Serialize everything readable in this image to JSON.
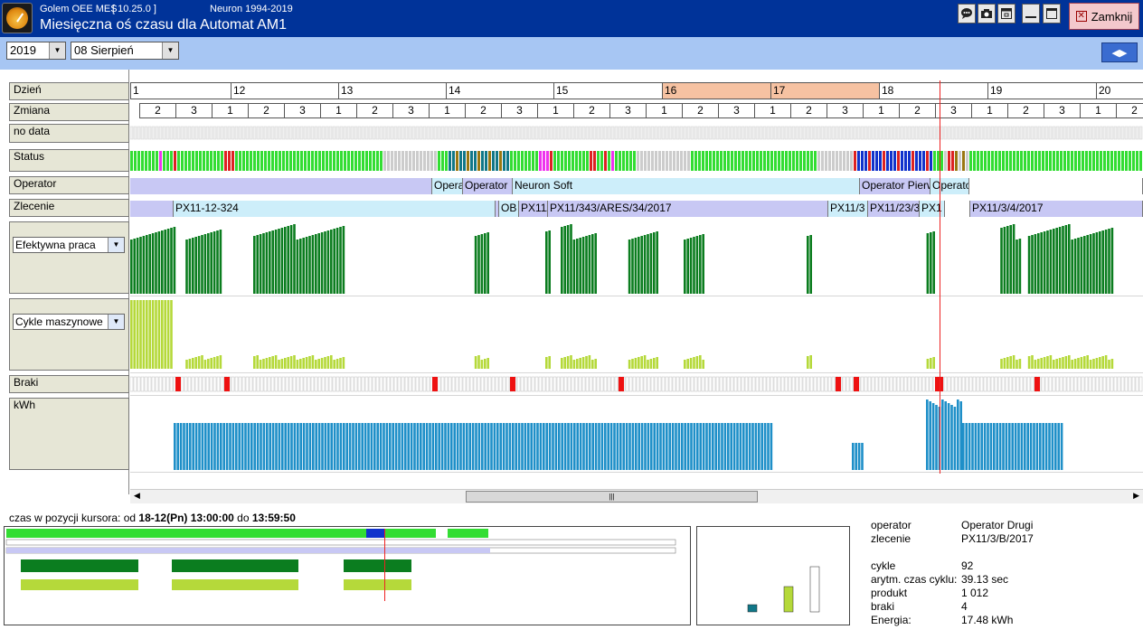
{
  "titlebar": {
    "app_name": "Golem OEE MES",
    "version": "[  10.25.0 ]",
    "copyright": "Neuron 1994-2019",
    "window_title": "Miesięczna oś czasu dla Automat AM1",
    "close_label": "Zamknij"
  },
  "toolbar": {
    "year": "2019",
    "month": "08  Sierpień"
  },
  "row_labels": {
    "day": "Dzień",
    "shift": "Zmiana",
    "nodata": "no data",
    "status": "Status",
    "operator": "Operator",
    "order": "Zlecenie",
    "effective": "Efektywna praca",
    "cycles": "Cykle maszynowe",
    "scrap": "Braki",
    "kwh": "kWh"
  },
  "days": [
    {
      "label": "1",
      "highlight": false
    },
    {
      "label": "12",
      "highlight": false
    },
    {
      "label": "13",
      "highlight": false
    },
    {
      "label": "14",
      "highlight": false
    },
    {
      "label": "15",
      "highlight": false
    },
    {
      "label": "16",
      "highlight": true
    },
    {
      "label": "17",
      "highlight": true
    },
    {
      "label": "18",
      "highlight": false
    },
    {
      "label": "19",
      "highlight": false
    },
    {
      "label": "20",
      "highlight": false
    }
  ],
  "shifts": [
    "2",
    "3",
    "1",
    "2",
    "3",
    "1",
    "2",
    "3",
    "1",
    "2",
    "3",
    "1",
    "2",
    "3",
    "1",
    "2",
    "3",
    "1",
    "2",
    "3",
    "1",
    "2",
    "3",
    "1",
    "2",
    "3",
    "1",
    "2"
  ],
  "operator_segments": [
    {
      "label": "",
      "color": "#c8c8f4"
    },
    {
      "label": "Operato",
      "color": "#cdeefa"
    },
    {
      "label": "Operator",
      "color": "#c8c8f4"
    },
    {
      "label": "Neuron Soft",
      "color": "#cdeefa"
    },
    {
      "label": "Operator Pierwszy",
      "color": "#c8c8f4"
    },
    {
      "label": "Operator",
      "color": "#cdeefa"
    },
    {
      "label": "",
      "color": "#ffffff"
    }
  ],
  "order_segments": [
    {
      "label": "",
      "color": "#c8c8f4"
    },
    {
      "label": "PX11-12-324",
      "color": "#cdeefa"
    },
    {
      "label": "I",
      "color": "#c8c8f4"
    },
    {
      "label": "OB",
      "color": "#cdeefa"
    },
    {
      "label": "PX11/",
      "color": "#c8c8f4"
    },
    {
      "label": "PX11/343/ARES/34/2017",
      "color": "#c8c8f4"
    },
    {
      "label": "PX11/3",
      "color": "#cdeefa"
    },
    {
      "label": "PX11/23/3",
      "color": "#c8c8f4"
    },
    {
      "label": "PX1",
      "color": "#cdeefa"
    },
    {
      "label": "",
      "color": "#ffffff"
    },
    {
      "label": "PX11/3/4/2017",
      "color": "#c8c8f4"
    }
  ],
  "colors": {
    "status_green": "#33dd33",
    "status_grey": "#cccccc",
    "status_red": "#dd2222",
    "status_blue": "#1133cc",
    "status_magenta": "#ee33ee",
    "status_teal": "#117788",
    "status_olive": "#997711",
    "effective_bar": "#0b7d1f",
    "cycles_bar": "#b5d93a",
    "scrap_red": "#ee1111",
    "kwh_bar": "#1e8fc8",
    "cursor_line": "#ee2222",
    "day_highlight": "#f6c2a2"
  },
  "cursor_info": {
    "prefix": "czas w pozycji kursora: od",
    "from": "18-12(Pn) 13:00:00",
    "middle": "do",
    "to": "13:59:50"
  },
  "details": [
    {
      "key": "operator",
      "value": "Operator Drugi"
    },
    {
      "key": "zlecenie",
      "value": "PX11/3/B/2017"
    },
    {
      "key": "cykle",
      "value": "92"
    },
    {
      "key": "arytm. czas cyklu:",
      "value": "39.13 sec"
    },
    {
      "key": "produkt",
      "value": "1 012"
    },
    {
      "key": "braki",
      "value": "4"
    },
    {
      "key": "Energia:",
      "value": "17.48 kWh"
    }
  ],
  "icons": [
    "chat-icon",
    "camera-icon",
    "window-icon",
    "minimize-icon",
    "maximize-icon",
    "close-icon",
    "chevron-down-icon",
    "left-right-arrows-icon",
    "gauge-logo-icon"
  ]
}
